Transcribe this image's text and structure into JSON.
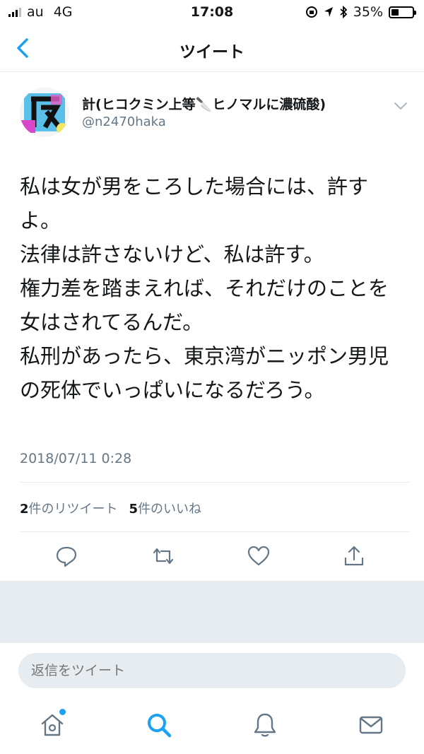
{
  "status_bar": {
    "carrier": "au",
    "network": "4G",
    "time": "17:08",
    "battery": "35%",
    "battery_level": 0.35
  },
  "nav": {
    "title": "ツイート",
    "back_icon": "chevron-left-icon"
  },
  "tweet": {
    "display_name": "計(ヒコクミン上等🔪ヒノマルに濃硫酸)",
    "handle": "@n2470haka",
    "text": "私は女が男をころした場合には、許すよ。\n法律は許さないけど、私は許す。\n権力差を踏まえれば、それだけのことを女はされてるんだ。\n私刑があったら、東京湾がニッポン男児の死体でいっぱいになるだろう。",
    "timestamp": "2018/07/11 0:28",
    "retweet_count": "2",
    "retweet_label": "件のリツイート",
    "like_count": "5",
    "like_label": "件のいいね"
  },
  "actions": [
    "reply-icon",
    "retweet-icon",
    "like-icon",
    "share-icon"
  ],
  "reply": {
    "placeholder": "返信をツイート"
  },
  "tabbar": [
    "home-icon",
    "search-icon",
    "notifications-icon",
    "messages-icon"
  ],
  "colors": {
    "accent": "#1da1f2",
    "text": "#14171a",
    "secondary": "#657786",
    "divider": "#e6ecf0"
  }
}
